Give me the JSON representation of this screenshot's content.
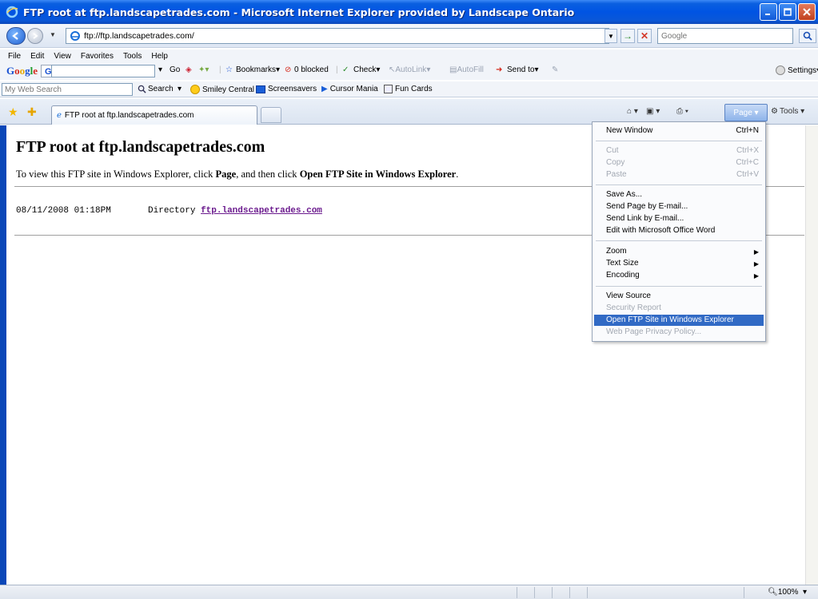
{
  "window": {
    "title": "FTP root at ftp.landscapetrades.com - Microsoft Internet Explorer provided by Landscape Ontario"
  },
  "address": {
    "url": "ftp://ftp.landscapetrades.com/",
    "search_placeholder": "Google"
  },
  "menubar": [
    "File",
    "Edit",
    "View",
    "Favorites",
    "Tools",
    "Help"
  ],
  "google_toolbar": {
    "logo": "Google",
    "go": "Go",
    "bookmarks": "Bookmarks",
    "blocked": "0 blocked",
    "check": "Check",
    "autolink": "AutoLink",
    "autofill": "AutoFill",
    "send_to": "Send to",
    "settings": "Settings"
  },
  "search_row": {
    "my_web_search": "My Web Search",
    "search": "Search",
    "smiley_central": "Smiley Central",
    "screensavers": "Screensavers",
    "cursor_mania": "Cursor Mania",
    "fun_cards": "Fun Cards"
  },
  "tab": {
    "title": "FTP root at ftp.landscapetrades.com"
  },
  "command_bar": {
    "page": "Page",
    "tools": "Tools"
  },
  "page": {
    "heading": "FTP root at ftp.landscapetrades.com",
    "instr_pre": "To view this FTP site in Windows Explorer, click ",
    "instr_page": "Page",
    "instr_mid": ", and then click ",
    "instr_open": "Open FTP Site in Windows Explorer",
    "instr_end": ".",
    "listing_date": "08/11/2008 01:18PM",
    "listing_type": "Directory",
    "listing_link": "ftp.landscapetrades.com"
  },
  "page_menu": {
    "new_window": "New Window",
    "new_window_sc": "Ctrl+N",
    "cut": "Cut",
    "cut_sc": "Ctrl+X",
    "copy": "Copy",
    "copy_sc": "Ctrl+C",
    "paste": "Paste",
    "paste_sc": "Ctrl+V",
    "save_as": "Save As...",
    "send_page": "Send Page by E-mail...",
    "send_link": "Send Link by E-mail...",
    "edit_word": "Edit with Microsoft Office Word",
    "zoom": "Zoom",
    "text_size": "Text Size",
    "encoding": "Encoding",
    "view_source": "View Source",
    "security_report": "Security Report",
    "open_ftp": "Open FTP Site in Windows Explorer",
    "privacy": "Web Page Privacy Policy..."
  },
  "status": {
    "zoom": "100%"
  }
}
